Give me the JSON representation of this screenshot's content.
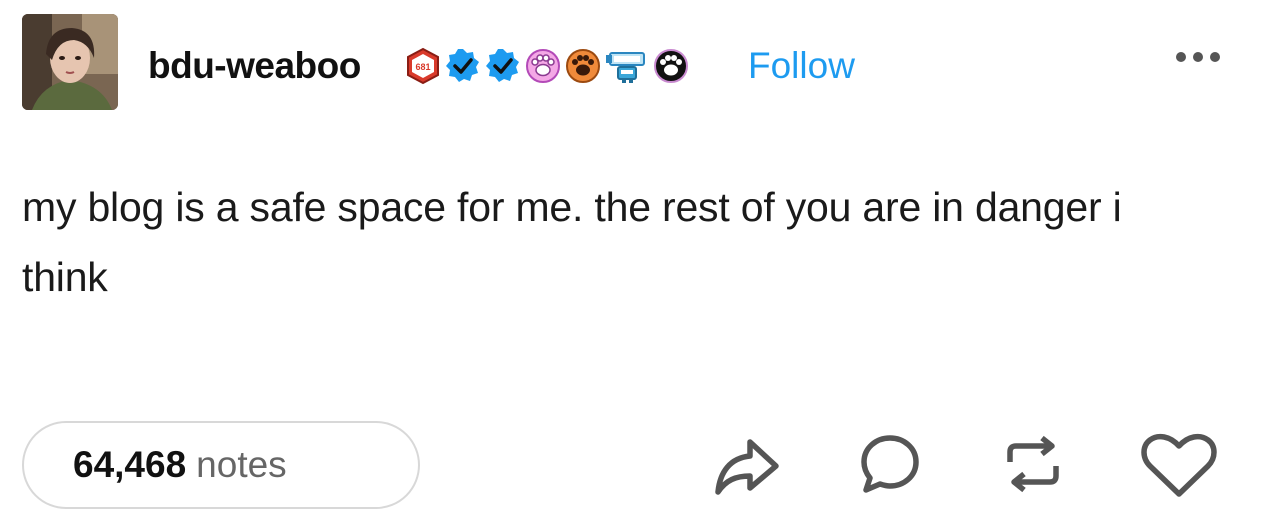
{
  "header": {
    "username": "bdu-weaboo",
    "follow_label": "Follow",
    "badges": [
      {
        "icon": "hexagon-badge-icon",
        "text": "681",
        "color": "#d93a2b"
      },
      {
        "icon": "verified-check-icon",
        "color": "#1d9bf0"
      },
      {
        "icon": "verified-check-icon",
        "color": "#1d9bf0"
      },
      {
        "icon": "paw-badge-icon",
        "color": "#c86fd0"
      },
      {
        "icon": "paw-badge-icon",
        "color": "#e08a2a"
      },
      {
        "icon": "robot-badge-icon",
        "color": "#3aa6d8"
      },
      {
        "icon": "paw-badge-icon",
        "color": "#111111"
      }
    ],
    "more_icon": "ellipsis-icon"
  },
  "post": {
    "text": "my blog is a safe space for me. the rest of you are in danger i think"
  },
  "footer": {
    "notes_count": "64,468",
    "notes_label": "notes",
    "actions": [
      "share-icon",
      "reply-icon",
      "reblog-icon",
      "like-icon"
    ]
  },
  "colors": {
    "follow": "#1d9bf0",
    "text": "#1a1a1a",
    "icon": "#555555",
    "pill_border": "#d8d8d8"
  }
}
